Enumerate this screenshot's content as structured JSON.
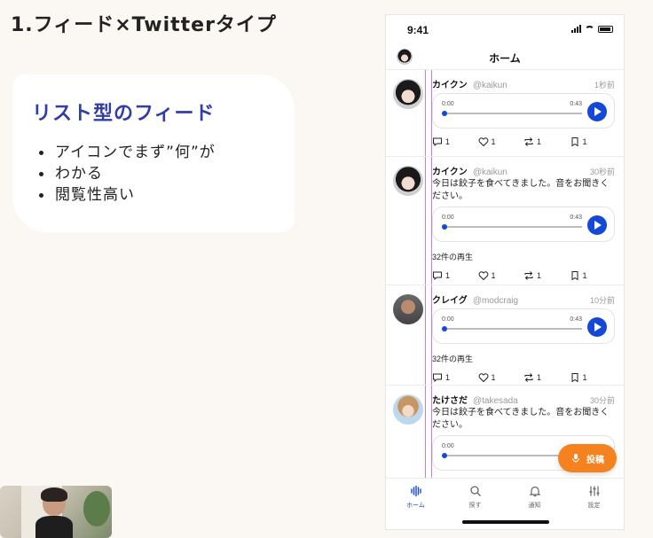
{
  "slide": {
    "title": "1.フィード×Twitterタイプ",
    "card_heading": "リスト型のフィード",
    "bullets": [
      "アイコンでまず”何”が",
      "わかる",
      "閲覧性高い"
    ]
  },
  "phone": {
    "status_time": "9:41",
    "nav_title": "ホーム",
    "posts": [
      {
        "name": "カイクン",
        "handle": "@kaikun",
        "time": "1秒前",
        "text": "",
        "player": {
          "start": "0:00",
          "end": "0:43"
        },
        "plays": "",
        "counts": {
          "comment": "1",
          "like": "1",
          "repost": "1",
          "bookmark": "1"
        }
      },
      {
        "name": "カイクン",
        "handle": "@kaikun",
        "time": "30秒前",
        "text": "今日は餃子を食べてきました。音をお聞きください。",
        "player": {
          "start": "0:00",
          "end": "0:43"
        },
        "plays": "32件の再生",
        "counts": {
          "comment": "1",
          "like": "1",
          "repost": "1",
          "bookmark": "1"
        }
      },
      {
        "name": "クレイグ",
        "handle": "@modcraig",
        "time": "10分前",
        "text": "",
        "player": {
          "start": "0:00",
          "end": "0:43"
        },
        "plays": "32件の再生",
        "counts": {
          "comment": "1",
          "like": "1",
          "repost": "1",
          "bookmark": "1"
        }
      },
      {
        "name": "たけさだ",
        "handle": "@takesada",
        "time": "30分前",
        "text": "今日は餃子を食べてきました。音をお聞きください。",
        "player": {
          "start": "0:00",
          "end": ""
        },
        "plays": "",
        "counts": {}
      }
    ],
    "fab_label": "投稿",
    "tabs": [
      {
        "label": "ホーム",
        "icon": "waveform-icon",
        "active": true
      },
      {
        "label": "探す",
        "icon": "search-icon",
        "active": false
      },
      {
        "label": "通知",
        "icon": "bell-icon",
        "active": false
      },
      {
        "label": "設定",
        "icon": "sliders-icon",
        "active": false
      }
    ],
    "accent_color": "#1448d8",
    "fab_color": "#f5821f",
    "guide_color": "#c97be0"
  }
}
